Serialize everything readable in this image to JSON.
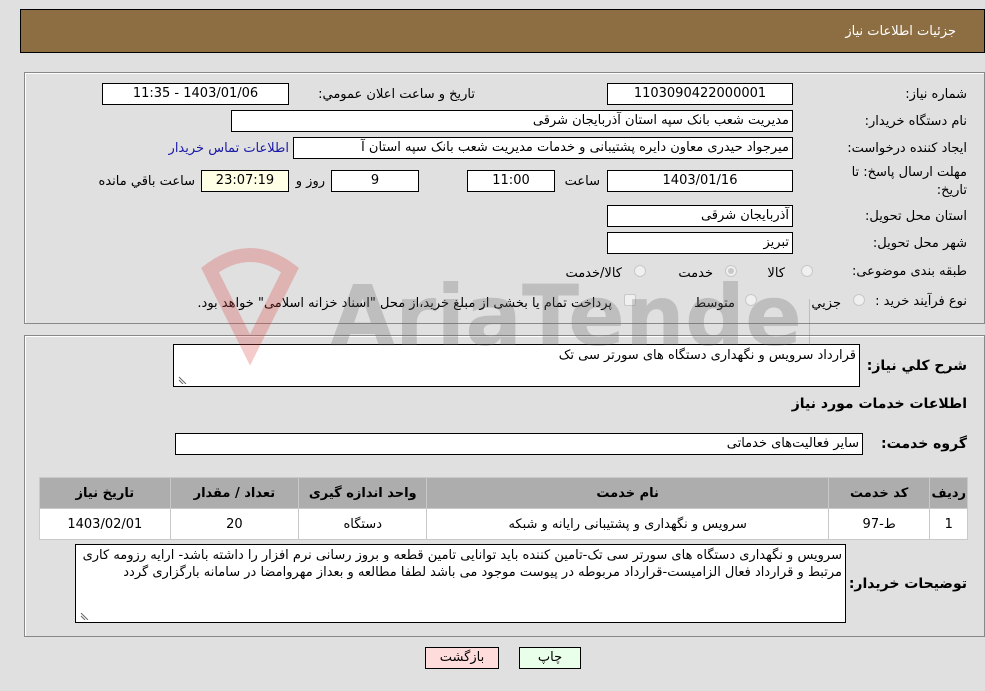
{
  "header": {
    "title": "جزئیات اطلاعات نیاز"
  },
  "fields": {
    "need_number": {
      "label": "شماره نیاز:",
      "value": "1103090422000001"
    },
    "announce_datetime": {
      "label": "تاريخ و ساعت اعلان عمومي:",
      "value": "1403/01/06 - 11:35"
    },
    "buyer_org": {
      "label": "نام دستگاه خريدار:",
      "value": "مديريت شعب بانک سپه استان آذربايجان شرقی"
    },
    "requester": {
      "label": "ايجاد کننده درخواست:",
      "value": "ميرجواد حيدری معاون دايره پشتيبانی و خدمات مديريت شعب بانک سپه استان آ",
      "contact_link": "اطلاعات تماس خريدار"
    },
    "deadline": {
      "label_line1": "مهلت ارسال پاسخ: تا",
      "label_line2": "تاريخ:",
      "date": "1403/01/16",
      "time_label": "ساعت",
      "time": "11:00",
      "days": "9",
      "days_label": "روز و",
      "remaining": "23:07:19",
      "remaining_label": "ساعت باقي مانده"
    },
    "province": {
      "label": "استان محل تحويل:",
      "value": "آذربايجان شرقی"
    },
    "city": {
      "label": "شهر محل تحويل:",
      "value": "تبريز"
    },
    "category": {
      "label": "طبقه بندی موضوعی:",
      "options": [
        {
          "label": "کالا",
          "checked": false
        },
        {
          "label": "خدمت",
          "checked": true
        },
        {
          "label": "کالا/خدمت",
          "checked": false
        }
      ]
    },
    "purchase_type": {
      "label": "نوع فرآيند خريد :",
      "options": [
        {
          "label": "جزيي",
          "checked": false
        },
        {
          "label": "متوسط",
          "checked": false
        }
      ],
      "treasury_note": "پرداخت تمام يا بخشی از مبلغ خريد،از محل \"اسناد خزانه اسلامی\" خواهد بود."
    }
  },
  "description": {
    "label": "شرح کلي نياز:",
    "value": "قرارداد سرويس و نگهداری دستگاه های سورتر سی تک"
  },
  "services_section": {
    "title": "اطلاعات خدمات مورد نياز"
  },
  "service_group": {
    "label": "گروه خدمت:",
    "value": "ساير فعاليت‌های خدماتی"
  },
  "services_table": {
    "headers": [
      "رديف",
      "کد خدمت",
      "نام خدمت",
      "واحد اندازه گيری",
      "تعداد / مقدار",
      "تاريخ نياز"
    ],
    "rows": [
      [
        "1",
        "ط-97",
        "سرويس و نگهداری و پشتيبانی رايانه و شبکه",
        "دستگاه",
        "20",
        "1403/02/01"
      ]
    ]
  },
  "buyer_notes": {
    "label": "توضيحات خريدار:",
    "value": "سرويس و نگهداری دستگاه های سورتر سی تک-تامين کننده بايد توانايی تامين قطعه و بروز رسانی نرم افزار را داشته باشد- ارايه رزومه کاری مرتبط و قرارداد فعال الزاميست-قرارداد مربوطه در پيوست موجود می باشد لطفا مطالعه و بعداز مهروامضا در سامانه بارگزاری گردد"
  },
  "buttons": {
    "print": "چاپ",
    "back": "بازگشت"
  },
  "watermark": {
    "text": "AriaTender.neT"
  }
}
